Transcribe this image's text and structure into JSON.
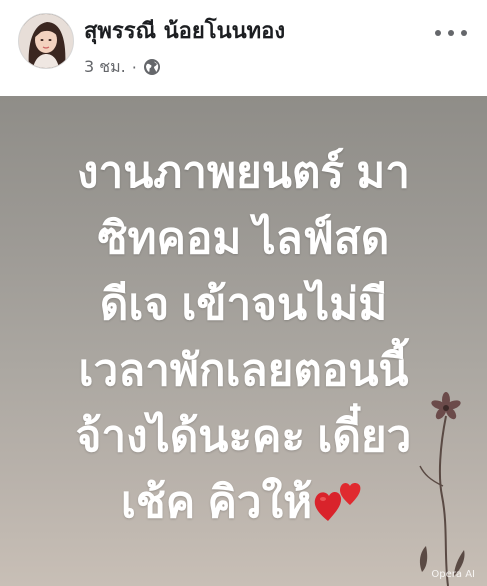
{
  "post": {
    "author": "สุพรรณี น้อยโนนทอง",
    "time": "3 ชม.",
    "separator": "·",
    "privacy_icon": "globe-icon",
    "more_icon": "more-icon"
  },
  "image": {
    "lines": [
      "งานภาพยนตร์ มา",
      "ซิทคอม ไลฟ์สด",
      "ดีเจ เข้าจนไม่มี",
      "เวลาพักเลยตอนนี้",
      "จ้างได้นะคะ เดี๋ยว",
      "เช้ค คิวให้"
    ],
    "heart_icon": "heart-icon",
    "watermark": "Opera AI"
  },
  "colors": {
    "name": "#1c1e21",
    "meta": "#65676b",
    "heart": "#d9232b"
  }
}
